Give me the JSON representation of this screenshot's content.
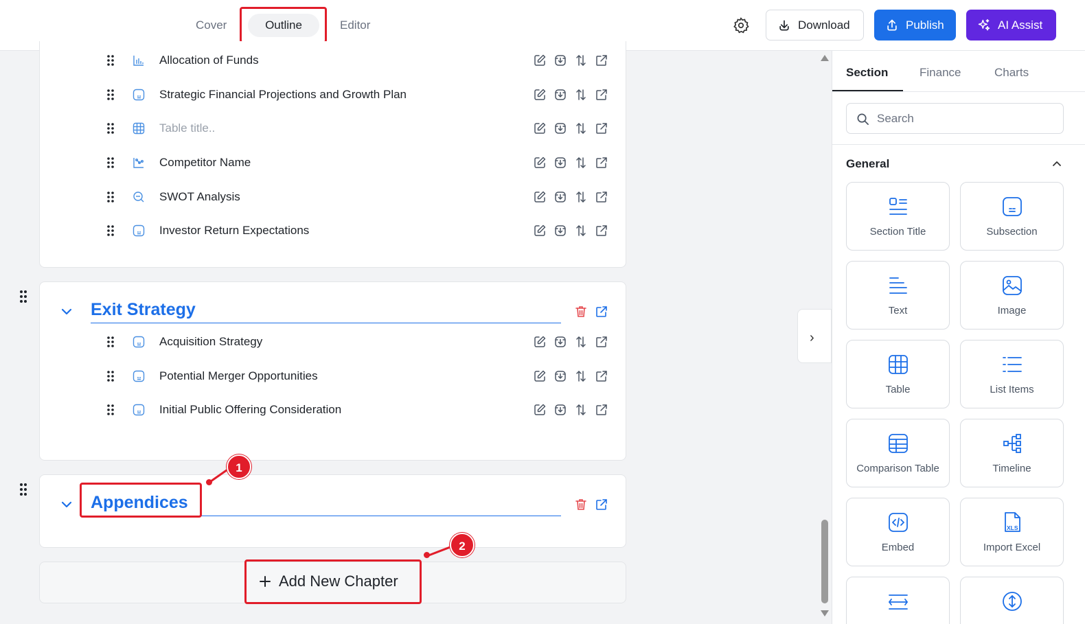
{
  "header": {
    "tabs": [
      {
        "label": "Cover"
      },
      {
        "label": "Outline",
        "active": true
      },
      {
        "label": "Editor"
      }
    ],
    "download_label": "Download",
    "publish_label": "Publish",
    "ai_label": "AI Assist",
    "icons": {
      "settings": "gear-icon",
      "download": "download-icon",
      "publish": "upload-icon",
      "ai": "sparkles-icon"
    },
    "colors": {
      "publish": "#1c6fe8",
      "ai": "#6127e0",
      "accent": "#1c6fe8",
      "annotation": "#e11d2a"
    }
  },
  "outline": {
    "chapters": [
      {
        "title": "",
        "items": [
          {
            "label": "Allocation of Funds",
            "icon": "bar-chart-icon"
          },
          {
            "label": "Strategic Financial Projections and Growth Plan",
            "icon": "subsection-icon"
          },
          {
            "label": "Table title..",
            "icon": "table-icon",
            "placeholder": true
          },
          {
            "label": "Competitor Name",
            "icon": "scatter-chart-icon"
          },
          {
            "label": "SWOT Analysis",
            "icon": "swot-icon"
          },
          {
            "label": "Investor Return Expectations",
            "icon": "subsection-icon"
          }
        ]
      },
      {
        "title": "Exit Strategy",
        "items": [
          {
            "label": "Acquisition Strategy",
            "icon": "subsection-icon"
          },
          {
            "label": "Potential Merger Opportunities",
            "icon": "subsection-icon"
          },
          {
            "label": "Initial Public Offering Consideration",
            "icon": "subsection-icon"
          }
        ]
      },
      {
        "title": "Appendices",
        "items": []
      }
    ],
    "add_chapter_label": "Add New Chapter",
    "annotations": [
      "1",
      "2"
    ]
  },
  "sidebar": {
    "tabs": [
      {
        "label": "Section",
        "active": true
      },
      {
        "label": "Finance"
      },
      {
        "label": "Charts"
      }
    ],
    "search_placeholder": "Search",
    "group_title": "General",
    "tiles": [
      {
        "label": "Section Title",
        "icon": "section-title-icon"
      },
      {
        "label": "Subsection",
        "icon": "subsection-icon"
      },
      {
        "label": "Text",
        "icon": "text-icon"
      },
      {
        "label": "Image",
        "icon": "image-icon"
      },
      {
        "label": "Table",
        "icon": "table-icon"
      },
      {
        "label": "List Items",
        "icon": "list-icon"
      },
      {
        "label": "Comparison Table",
        "icon": "comparison-table-icon"
      },
      {
        "label": "Timeline",
        "icon": "timeline-icon"
      },
      {
        "label": "Embed",
        "icon": "embed-icon"
      },
      {
        "label": "Import Excel",
        "icon": "excel-icon"
      },
      {
        "label": "",
        "icon": "spacer-icon"
      },
      {
        "label": "",
        "icon": "page-break-icon"
      }
    ]
  }
}
